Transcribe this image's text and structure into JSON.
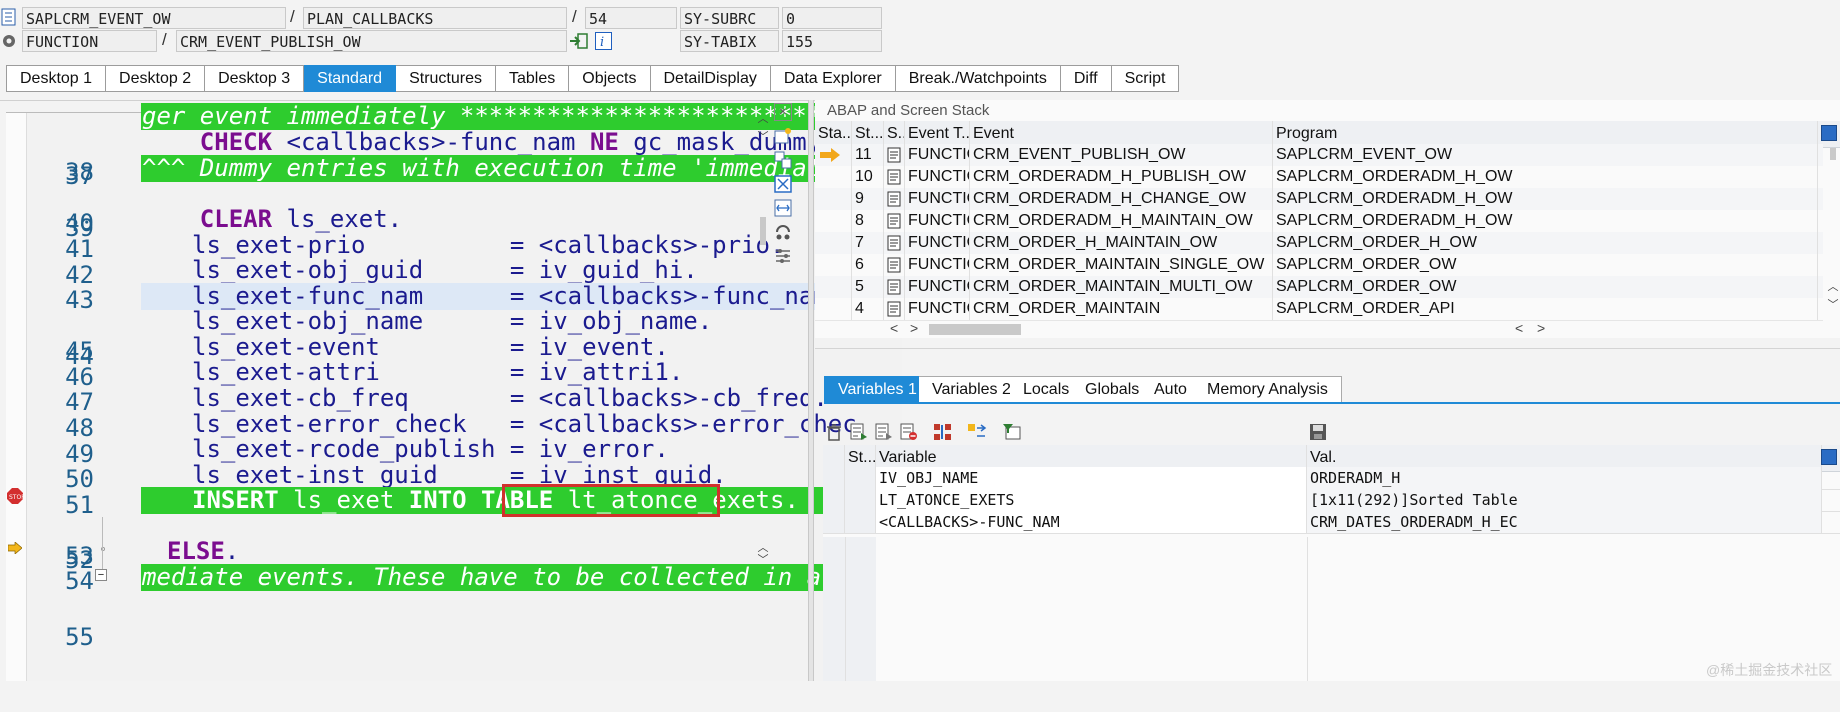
{
  "header": {
    "program": "SAPLCRM_EVENT_OW",
    "include": "PLAN_CALLBACKS",
    "line": "54",
    "sy_subrc_label": "SY-SUBRC",
    "sy_subrc_value": "0",
    "type": "FUNCTION",
    "function_name": "CRM_EVENT_PUBLISH_OW",
    "sy_tabix_label": "SY-TABIX",
    "sy_tabix_value": "155",
    "slash": "/"
  },
  "tabs": [
    "Desktop 1",
    "Desktop 2",
    "Desktop 3",
    "Standard",
    "Structures",
    "Tables",
    "Objects",
    "DetailDisplay",
    "Data Explorer",
    "Break./Watchpoints",
    "Diff",
    "Script"
  ],
  "code": {
    "lines": [
      {
        "n": "37"
      },
      {
        "n": "38"
      },
      {
        "n": "39"
      },
      {
        "n": "40"
      },
      {
        "n": "41"
      },
      {
        "n": "42"
      },
      {
        "n": "43"
      },
      {
        "n": "44"
      },
      {
        "n": "45"
      },
      {
        "n": "46"
      },
      {
        "n": "47"
      },
      {
        "n": "48"
      },
      {
        "n": "49"
      },
      {
        "n": "50"
      },
      {
        "n": "51"
      },
      {
        "n": "52"
      },
      {
        "n": "53"
      },
      {
        "n": "54"
      },
      {
        "n": "55"
      }
    ],
    "l37": "ger event immediately *******************************",
    "l38_kw": "CHECK",
    "l38_rest": " <callbacks>-func_nam ",
    "l38_kw2": "NE",
    "l38_rest2": " gc_mask_dummy.",
    "l39": "^^^ Dummy entries with execution time 'immediately",
    "l41_kw": "CLEAR",
    "l41_rest": " ls_exet.",
    "l42": "ls_exet-prio          = <callbacks>-prio.",
    "l43": "ls_exet-obj_guid      = iv_guid_hi.",
    "l44": "ls_exet-func_nam      = <callbacks>-func_nam.",
    "l45": "ls_exet-obj_name      = iv_obj_name.",
    "l46": "ls_exet-event         = iv_event.",
    "l47": "ls_exet-attri         = iv_attri1.",
    "l48": "ls_exet-cb_freq       = <callbacks>-cb_freq.",
    "l49": "ls_exet-error_check   = <callbacks>-error_chec",
    "l50": "ls_exet-rcode_publish = iv_error.",
    "l51": "ls_exet-inst_guid     = iv_inst_guid.",
    "l52_kw": "INSERT",
    "l52_mid": " ls_exet ",
    "l52_kw2": "INTO TABLE",
    "l52_rest": " lt_atonce_exets.",
    "l54_kw": "ELSE",
    "l54_rest": ".",
    "l55": "mediate events. These have to be collected in a pl"
  },
  "stack": {
    "title": "ABAP and Screen Stack",
    "columns": [
      "Sta...",
      "St...",
      "S...",
      "Event T...",
      "Event",
      "Program"
    ],
    "rows": [
      {
        "level": "11",
        "type": "FUNCTIO...",
        "event": "CRM_EVENT_PUBLISH_OW",
        "program": "SAPLCRM_EVENT_OW",
        "current": true
      },
      {
        "level": "10",
        "type": "FUNCTIO...",
        "event": "CRM_ORDERADM_H_PUBLISH_OW",
        "program": "SAPLCRM_ORDERADM_H_OW"
      },
      {
        "level": "9",
        "type": "FUNCTIO...",
        "event": "CRM_ORDERADM_H_CHANGE_OW",
        "program": "SAPLCRM_ORDERADM_H_OW"
      },
      {
        "level": "8",
        "type": "FUNCTIO...",
        "event": "CRM_ORDERADM_H_MAINTAIN_OW",
        "program": "SAPLCRM_ORDERADM_H_OW"
      },
      {
        "level": "7",
        "type": "FUNCTIO...",
        "event": "CRM_ORDER_H_MAINTAIN_OW",
        "program": "SAPLCRM_ORDER_H_OW"
      },
      {
        "level": "6",
        "type": "FUNCTIO...",
        "event": "CRM_ORDER_MAINTAIN_SINGLE_OW",
        "program": "SAPLCRM_ORDER_OW"
      },
      {
        "level": "5",
        "type": "FUNCTIO...",
        "event": "CRM_ORDER_MAINTAIN_MULTI_OW",
        "program": "SAPLCRM_ORDER_OW"
      },
      {
        "level": "4",
        "type": "FUNCTIO...",
        "event": "CRM_ORDER_MAINTAIN",
        "program": "SAPLCRM_ORDER_API"
      }
    ]
  },
  "var_tabs": [
    "Variables 1",
    "Variables 2",
    "Locals",
    "Globals",
    "Auto",
    "Memory Analysis"
  ],
  "vars": {
    "columns": [
      "St...",
      "Variable",
      "Val."
    ],
    "rows": [
      {
        "name": "IV_OBJ_NAME",
        "value": "ORDERADM_H"
      },
      {
        "name": "LT_ATONCE_EXETS",
        "value": "[1x11(292)]Sorted Table"
      },
      {
        "name": "<CALLBACKS>-FUNC_NAM",
        "value": "CRM_DATES_ORDERADM_H_EC"
      }
    ]
  },
  "watermark": "@稀土掘金技术社区"
}
